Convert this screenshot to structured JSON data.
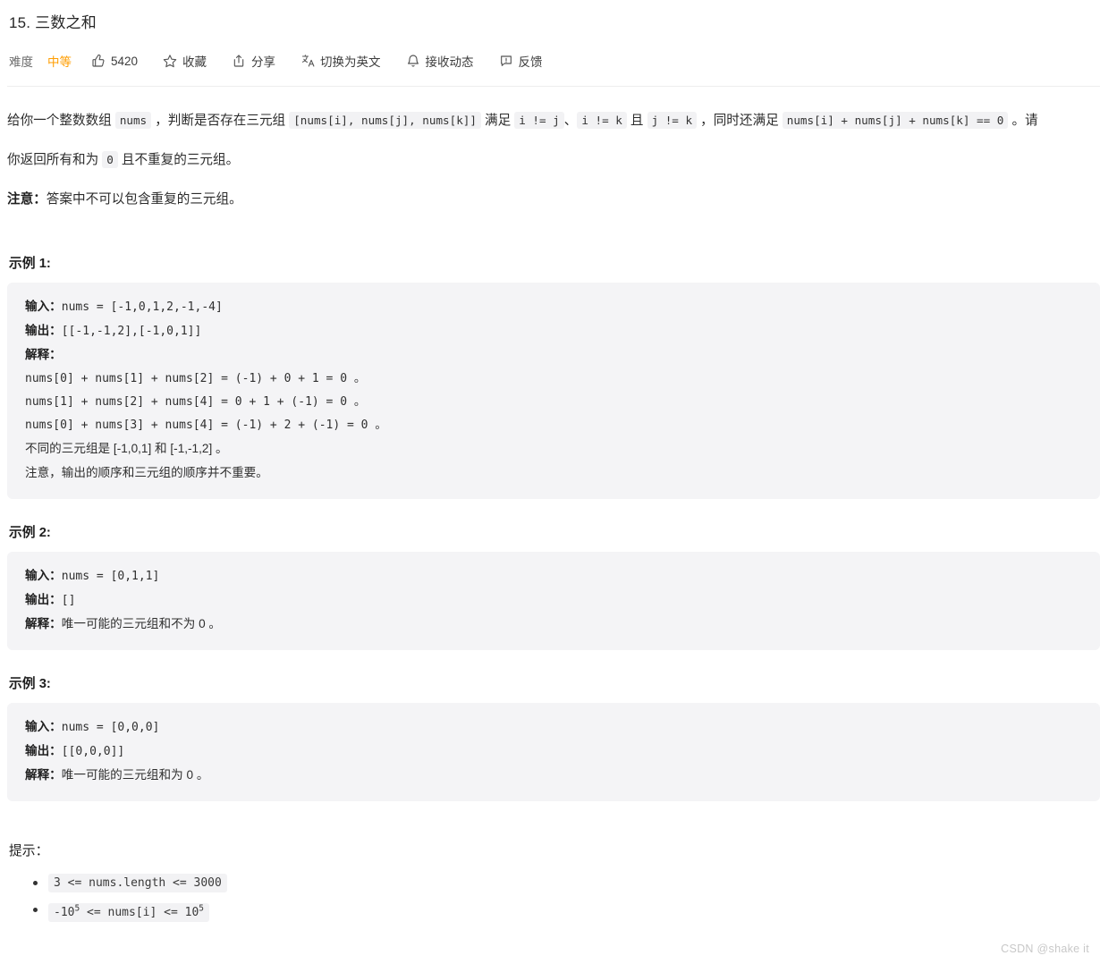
{
  "header": {
    "title": "15. 三数之和",
    "toolbar": {
      "difficulty_label": "难度",
      "difficulty_value": "中等",
      "difficulty_color": "#ff9d00",
      "likes": "5420",
      "favorite": "收藏",
      "share": "分享",
      "translate": "切换为英文",
      "subscribe": "接收动态",
      "feedback": "反馈",
      "icons": {
        "like": "thumbs-up-icon",
        "favorite": "star-icon",
        "share": "share-icon",
        "translate": "translate-icon",
        "subscribe": "bell-icon",
        "feedback": "feedback-icon"
      }
    }
  },
  "description": {
    "p1": {
      "t1": "给你一个整数数组 ",
      "c1": "nums",
      "t2": " ，判断是否存在三元组 ",
      "c2": "[nums[i], nums[j], nums[k]]",
      "t3": " 满足 ",
      "c3": "i != j",
      "t4": "、",
      "c4": "i != k",
      "t5": " 且 ",
      "c5": "j != k",
      "t6": " ，同时还满足 ",
      "c6": "nums[i] + nums[j] + nums[k] == 0",
      "t7": " 。请"
    },
    "p2": {
      "t1": "你返回所有和为 ",
      "c1": "0",
      "t2": " 且不重复的三元组。"
    },
    "p3": {
      "label": "注意：",
      "text": "答案中不可以包含重复的三元组。"
    }
  },
  "examples": [
    {
      "title": "示例 1:",
      "lines": [
        {
          "label": "输入：",
          "code": "nums = [-1,0,1,2,-1,-4]"
        },
        {
          "label": "输出：",
          "code": "[[-1,-1,2],[-1,0,1]]"
        },
        {
          "label": "解释：",
          "code": ""
        },
        {
          "label": "",
          "code": "nums[0] + nums[1] + nums[2] = (-1) + 0 + 1 = 0 。"
        },
        {
          "label": "",
          "code": "nums[1] + nums[2] + nums[4] = 0 + 1 + (-1) = 0 。"
        },
        {
          "label": "",
          "code": "nums[0] + nums[3] + nums[4] = (-1) + 2 + (-1) = 0 。"
        },
        {
          "label": "",
          "code": "不同的三元组是 [-1,0,1] 和 [-1,-1,2] 。"
        },
        {
          "label": "",
          "code": "注意，输出的顺序和三元组的顺序并不重要。"
        }
      ]
    },
    {
      "title": "示例 2:",
      "lines": [
        {
          "label": "输入：",
          "code": "nums = [0,1,1]"
        },
        {
          "label": "输出：",
          "code": "[]"
        },
        {
          "label": "解释：",
          "code": "唯一可能的三元组和不为 0 。"
        }
      ]
    },
    {
      "title": "示例 3:",
      "lines": [
        {
          "label": "输入：",
          "code": "nums = [0,0,0]"
        },
        {
          "label": "输出：",
          "code": "[[0,0,0]]"
        },
        {
          "label": "解释：",
          "code": "唯一可能的三元组和为 0 。"
        }
      ]
    }
  ],
  "hints": {
    "title": "提示：",
    "items": [
      {
        "pre": "3 <= nums.length <= 3000",
        "sup": "",
        "post": ""
      },
      {
        "pre": "-10",
        "sup": "5",
        "mid": " <= nums[i] <= 10",
        "sup2": "5",
        "post": ""
      }
    ]
  },
  "watermark": "CSDN @shake it"
}
